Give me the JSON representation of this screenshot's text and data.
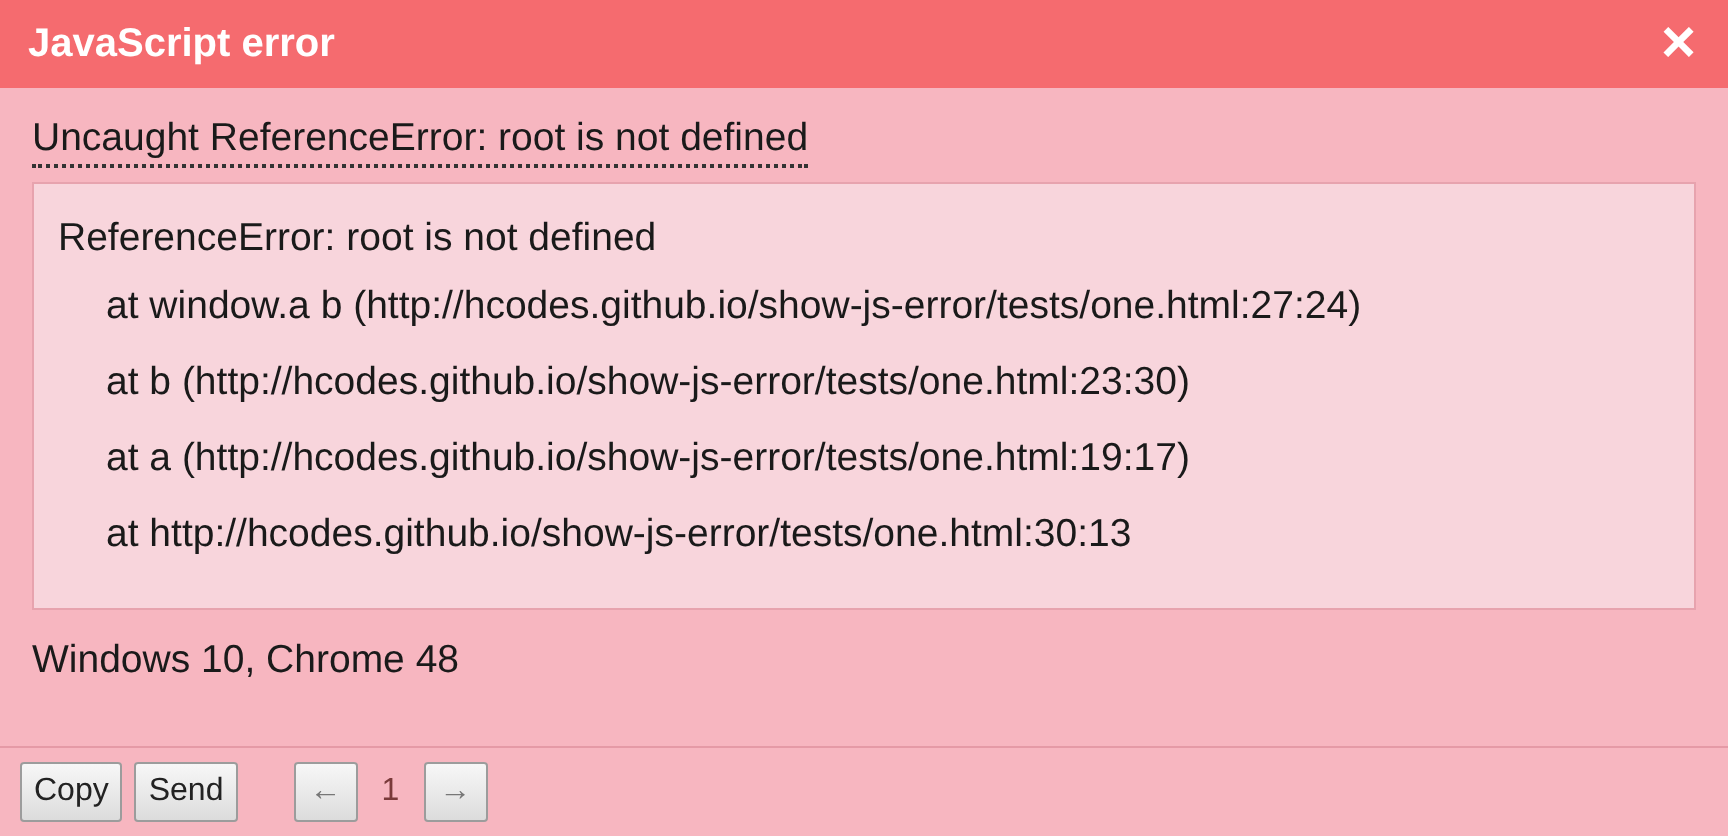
{
  "window": {
    "title": "JavaScript error",
    "close": "×"
  },
  "message": "Uncaught ReferenceError: root is not defined",
  "stack": {
    "header": "ReferenceError: root is not defined",
    "frames": [
      "at window.a b (http://hcodes.github.io/show-js-error/tests/one.html:27:24)",
      "at b (http://hcodes.github.io/show-js-error/tests/one.html:23:30)",
      "at a (http://hcodes.github.io/show-js-error/tests/one.html:19:17)",
      "at http://hcodes.github.io/show-js-error/tests/one.html:30:13"
    ]
  },
  "environment": "Windows 10, Chrome 48",
  "buttons": [
    "Copy",
    "Send"
  ],
  "pager": {
    "prev": "←",
    "page": "1",
    "next": "→"
  }
}
